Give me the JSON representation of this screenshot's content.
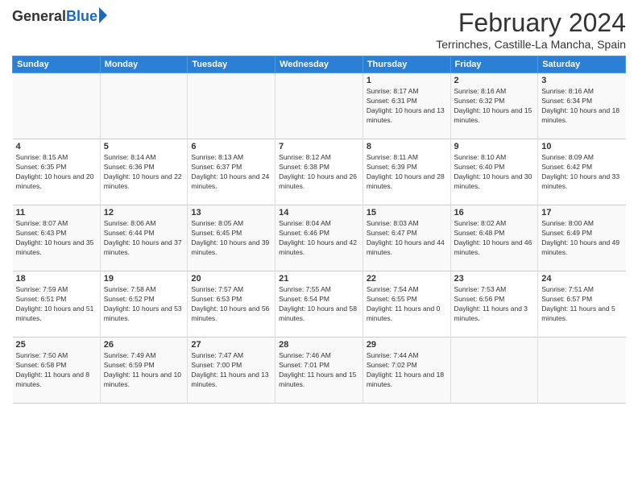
{
  "logo": {
    "general": "General",
    "blue": "Blue"
  },
  "title": "February 2024",
  "location": "Terrinches, Castille-La Mancha, Spain",
  "header_days": [
    "Sunday",
    "Monday",
    "Tuesday",
    "Wednesday",
    "Thursday",
    "Friday",
    "Saturday"
  ],
  "weeks": [
    [
      {
        "day": "",
        "sunrise": "",
        "sunset": "",
        "daylight": ""
      },
      {
        "day": "",
        "sunrise": "",
        "sunset": "",
        "daylight": ""
      },
      {
        "day": "",
        "sunrise": "",
        "sunset": "",
        "daylight": ""
      },
      {
        "day": "",
        "sunrise": "",
        "sunset": "",
        "daylight": ""
      },
      {
        "day": "1",
        "sunrise": "Sunrise: 8:17 AM",
        "sunset": "Sunset: 6:31 PM",
        "daylight": "Daylight: 10 hours and 13 minutes."
      },
      {
        "day": "2",
        "sunrise": "Sunrise: 8:16 AM",
        "sunset": "Sunset: 6:32 PM",
        "daylight": "Daylight: 10 hours and 15 minutes."
      },
      {
        "day": "3",
        "sunrise": "Sunrise: 8:16 AM",
        "sunset": "Sunset: 6:34 PM",
        "daylight": "Daylight: 10 hours and 18 minutes."
      }
    ],
    [
      {
        "day": "4",
        "sunrise": "Sunrise: 8:15 AM",
        "sunset": "Sunset: 6:35 PM",
        "daylight": "Daylight: 10 hours and 20 minutes."
      },
      {
        "day": "5",
        "sunrise": "Sunrise: 8:14 AM",
        "sunset": "Sunset: 6:36 PM",
        "daylight": "Daylight: 10 hours and 22 minutes."
      },
      {
        "day": "6",
        "sunrise": "Sunrise: 8:13 AM",
        "sunset": "Sunset: 6:37 PM",
        "daylight": "Daylight: 10 hours and 24 minutes."
      },
      {
        "day": "7",
        "sunrise": "Sunrise: 8:12 AM",
        "sunset": "Sunset: 6:38 PM",
        "daylight": "Daylight: 10 hours and 26 minutes."
      },
      {
        "day": "8",
        "sunrise": "Sunrise: 8:11 AM",
        "sunset": "Sunset: 6:39 PM",
        "daylight": "Daylight: 10 hours and 28 minutes."
      },
      {
        "day": "9",
        "sunrise": "Sunrise: 8:10 AM",
        "sunset": "Sunset: 6:40 PM",
        "daylight": "Daylight: 10 hours and 30 minutes."
      },
      {
        "day": "10",
        "sunrise": "Sunrise: 8:09 AM",
        "sunset": "Sunset: 6:42 PM",
        "daylight": "Daylight: 10 hours and 33 minutes."
      }
    ],
    [
      {
        "day": "11",
        "sunrise": "Sunrise: 8:07 AM",
        "sunset": "Sunset: 6:43 PM",
        "daylight": "Daylight: 10 hours and 35 minutes."
      },
      {
        "day": "12",
        "sunrise": "Sunrise: 8:06 AM",
        "sunset": "Sunset: 6:44 PM",
        "daylight": "Daylight: 10 hours and 37 minutes."
      },
      {
        "day": "13",
        "sunrise": "Sunrise: 8:05 AM",
        "sunset": "Sunset: 6:45 PM",
        "daylight": "Daylight: 10 hours and 39 minutes."
      },
      {
        "day": "14",
        "sunrise": "Sunrise: 8:04 AM",
        "sunset": "Sunset: 6:46 PM",
        "daylight": "Daylight: 10 hours and 42 minutes."
      },
      {
        "day": "15",
        "sunrise": "Sunrise: 8:03 AM",
        "sunset": "Sunset: 6:47 PM",
        "daylight": "Daylight: 10 hours and 44 minutes."
      },
      {
        "day": "16",
        "sunrise": "Sunrise: 8:02 AM",
        "sunset": "Sunset: 6:48 PM",
        "daylight": "Daylight: 10 hours and 46 minutes."
      },
      {
        "day": "17",
        "sunrise": "Sunrise: 8:00 AM",
        "sunset": "Sunset: 6:49 PM",
        "daylight": "Daylight: 10 hours and 49 minutes."
      }
    ],
    [
      {
        "day": "18",
        "sunrise": "Sunrise: 7:59 AM",
        "sunset": "Sunset: 6:51 PM",
        "daylight": "Daylight: 10 hours and 51 minutes."
      },
      {
        "day": "19",
        "sunrise": "Sunrise: 7:58 AM",
        "sunset": "Sunset: 6:52 PM",
        "daylight": "Daylight: 10 hours and 53 minutes."
      },
      {
        "day": "20",
        "sunrise": "Sunrise: 7:57 AM",
        "sunset": "Sunset: 6:53 PM",
        "daylight": "Daylight: 10 hours and 56 minutes."
      },
      {
        "day": "21",
        "sunrise": "Sunrise: 7:55 AM",
        "sunset": "Sunset: 6:54 PM",
        "daylight": "Daylight: 10 hours and 58 minutes."
      },
      {
        "day": "22",
        "sunrise": "Sunrise: 7:54 AM",
        "sunset": "Sunset: 6:55 PM",
        "daylight": "Daylight: 11 hours and 0 minutes."
      },
      {
        "day": "23",
        "sunrise": "Sunrise: 7:53 AM",
        "sunset": "Sunset: 6:56 PM",
        "daylight": "Daylight: 11 hours and 3 minutes."
      },
      {
        "day": "24",
        "sunrise": "Sunrise: 7:51 AM",
        "sunset": "Sunset: 6:57 PM",
        "daylight": "Daylight: 11 hours and 5 minutes."
      }
    ],
    [
      {
        "day": "25",
        "sunrise": "Sunrise: 7:50 AM",
        "sunset": "Sunset: 6:58 PM",
        "daylight": "Daylight: 11 hours and 8 minutes."
      },
      {
        "day": "26",
        "sunrise": "Sunrise: 7:49 AM",
        "sunset": "Sunset: 6:59 PM",
        "daylight": "Daylight: 11 hours and 10 minutes."
      },
      {
        "day": "27",
        "sunrise": "Sunrise: 7:47 AM",
        "sunset": "Sunset: 7:00 PM",
        "daylight": "Daylight: 11 hours and 13 minutes."
      },
      {
        "day": "28",
        "sunrise": "Sunrise: 7:46 AM",
        "sunset": "Sunset: 7:01 PM",
        "daylight": "Daylight: 11 hours and 15 minutes."
      },
      {
        "day": "29",
        "sunrise": "Sunrise: 7:44 AM",
        "sunset": "Sunset: 7:02 PM",
        "daylight": "Daylight: 11 hours and 18 minutes."
      },
      {
        "day": "",
        "sunrise": "",
        "sunset": "",
        "daylight": ""
      },
      {
        "day": "",
        "sunrise": "",
        "sunset": "",
        "daylight": ""
      }
    ]
  ]
}
